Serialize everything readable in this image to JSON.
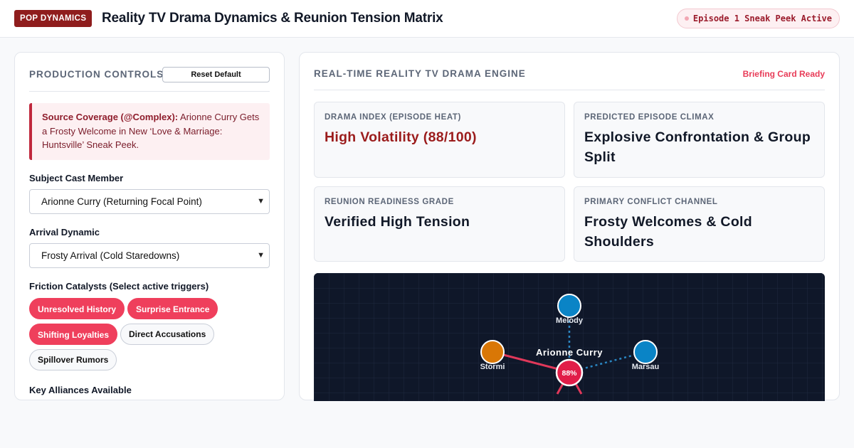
{
  "header": {
    "brand": "POP DYNAMICS",
    "title": "Reality TV Drama Dynamics & Reunion Tension Matrix",
    "status": "Episode 1 Sneak Peek Active"
  },
  "controls": {
    "heading": "PRODUCTION CONTROLS",
    "reset_label": "Reset Default",
    "source_label": "Source Coverage (@Complex):",
    "source_text": " Arionne Curry Gets a Frosty Welcome in New ‘Love & Marriage: Huntsville’ Sneak Peek.",
    "cast_label": "Subject Cast Member",
    "cast_value": "Arionne Curry (Returning Focal Point)",
    "arrival_label": "Arrival Dynamic",
    "arrival_value": "Frosty Arrival (Cold Staredowns)",
    "catalysts_label": "Friction Catalysts (Select active triggers)",
    "catalysts": [
      {
        "label": "Unresolved History",
        "active": true
      },
      {
        "label": "Surprise Entrance",
        "active": true
      },
      {
        "label": "Shifting Loyalties",
        "active": true
      },
      {
        "label": "Direct Accusations",
        "active": false
      },
      {
        "label": "Spillover Rumors",
        "active": false
      }
    ],
    "clipped_label": "Key Alliances Available"
  },
  "engine": {
    "heading": "REAL-TIME REALITY TV DRAMA ENGINE",
    "briefing_status": "Briefing Card Ready",
    "metrics": [
      {
        "label": "DRAMA INDEX (EPISODE HEAT)",
        "value": "High Volatility (88/100)"
      },
      {
        "label": "PREDICTED EPISODE CLIMAX",
        "value": "Explosive Confrontation & Group Split"
      },
      {
        "label": "REUNION READINESS GRADE",
        "value": "Verified High Tension"
      },
      {
        "label": "PRIMARY CONFLICT CHANNEL",
        "value": "Frosty Welcomes & Cold Shoulders"
      }
    ]
  },
  "graph": {
    "center_name": "Arionne Curry",
    "center_score": "88%",
    "nodes": [
      {
        "name": "Melody",
        "color": "#0a84c6",
        "relation": "neutral"
      },
      {
        "name": "Stormi",
        "color": "#d97706",
        "relation": "conflict"
      },
      {
        "name": "Marsau",
        "color": "#0a84c6",
        "relation": "neutral"
      }
    ],
    "colors": {
      "background": "#0f1729",
      "center": "#e11d48",
      "conflict_edge": "#e0385a",
      "neutral_edge": "#2a86c2"
    }
  }
}
